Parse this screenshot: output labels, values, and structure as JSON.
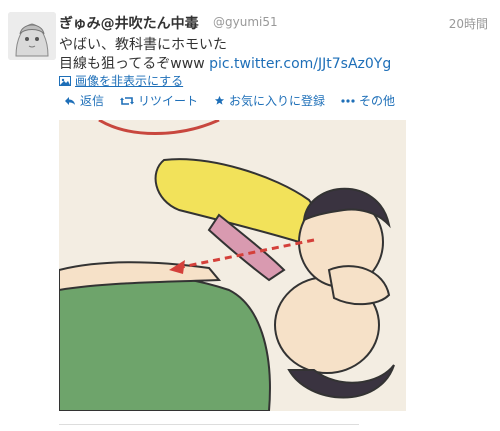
{
  "tweet": {
    "display_name": "ぎゅみ@井吹たん中毒",
    "handle": "@gyumi51",
    "time": "20時間",
    "text_line1": "やばい、教科書にホモいた",
    "text_line2_prefix": "目線も狙ってるぞwww ",
    "text_link": "pic.twitter.com/JJt7sAz0Yg",
    "media_toggle_label": "画像を非表示にする"
  },
  "actions": {
    "reply": "返信",
    "retweet": "リツイート",
    "favorite": "お気に入りに登録",
    "more": "その他"
  },
  "icons": {
    "reply": "reply-icon",
    "retweet": "retweet-icon",
    "favorite": "star-icon",
    "more": "more-icon",
    "media": "image-icon"
  },
  "colors": {
    "link": "#1e6fb8",
    "name": "#333333",
    "meta": "#999999"
  }
}
